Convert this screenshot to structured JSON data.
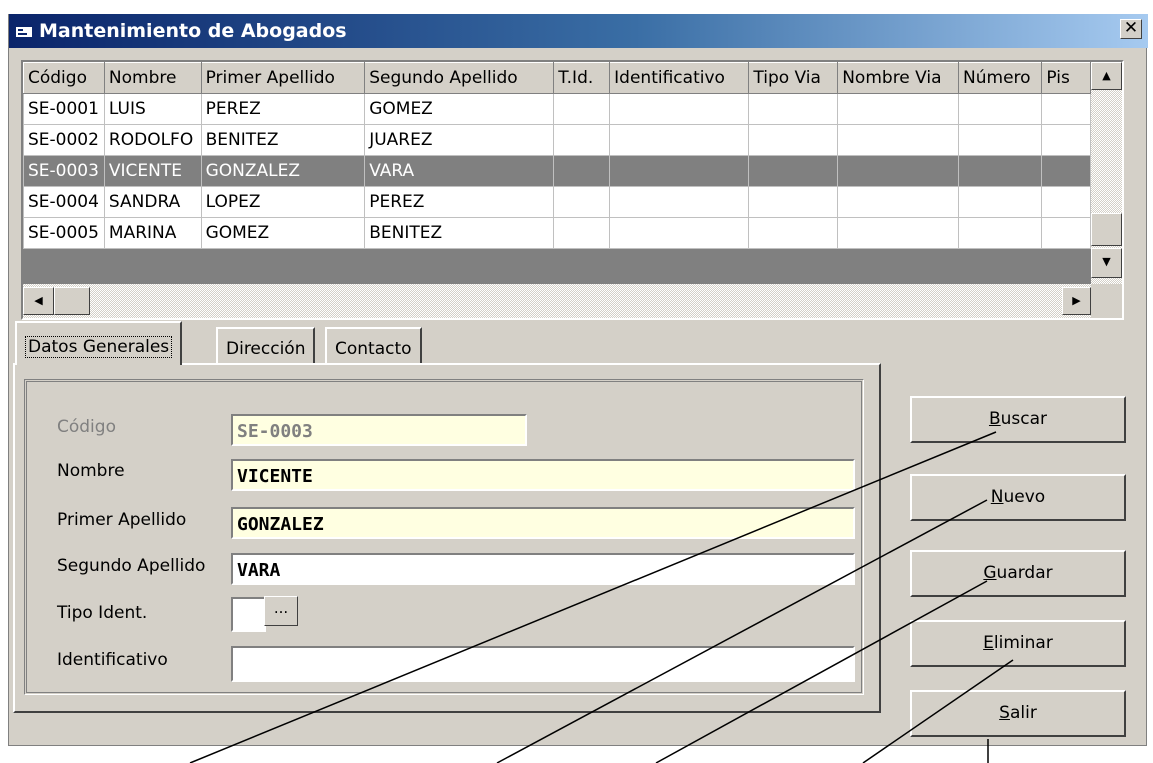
{
  "window": {
    "title": "Mantenimiento de Abogados",
    "close_glyph": "✕"
  },
  "grid": {
    "columns": [
      "Código",
      "Nombre",
      "Primer Apellido",
      "Segundo Apellido",
      "T.Id.",
      "Identificativo",
      "Tipo Via",
      "Nombre Via",
      "Número",
      "Pis"
    ],
    "rows": [
      [
        "SE-0001",
        "LUIS",
        "PEREZ",
        "GOMEZ",
        "",
        "",
        "",
        "",
        "",
        ""
      ],
      [
        "SE-0002",
        "RODOLFO",
        "BENITEZ",
        "JUAREZ",
        "",
        "",
        "",
        "",
        "",
        ""
      ],
      [
        "SE-0003",
        "VICENTE",
        "GONZALEZ",
        "VARA",
        "",
        "",
        "",
        "",
        "",
        ""
      ],
      [
        "SE-0004",
        "SANDRA",
        "LOPEZ",
        "PEREZ",
        "",
        "",
        "",
        "",
        "",
        ""
      ],
      [
        "SE-0005",
        "MARINA",
        "GOMEZ",
        "BENITEZ",
        "",
        "",
        "",
        "",
        "",
        ""
      ]
    ],
    "selected_row": 2
  },
  "tabs": [
    {
      "label": "Datos Generales"
    },
    {
      "label": "Dirección"
    },
    {
      "label": "Contacto"
    }
  ],
  "form": {
    "codigo_label": "Código",
    "codigo_value": "SE-0003",
    "nombre_label": "Nombre",
    "nombre_value": "VICENTE",
    "primer_label": "Primer Apellido",
    "primer_value": "GONZALEZ",
    "segundo_label": "Segundo Apellido",
    "segundo_value": "VARA",
    "tipo_label": "Tipo Ident.",
    "tipo_value": "",
    "ellipsis": "...",
    "ident_label": "Identificativo",
    "ident_value": ""
  },
  "buttons": [
    {
      "accel": "B",
      "rest": "uscar"
    },
    {
      "accel": "N",
      "rest": "uevo"
    },
    {
      "accel": "G",
      "rest": "uardar"
    },
    {
      "accel": "E",
      "rest": "liminar"
    },
    {
      "accel": "S",
      "rest": "alir"
    }
  ]
}
